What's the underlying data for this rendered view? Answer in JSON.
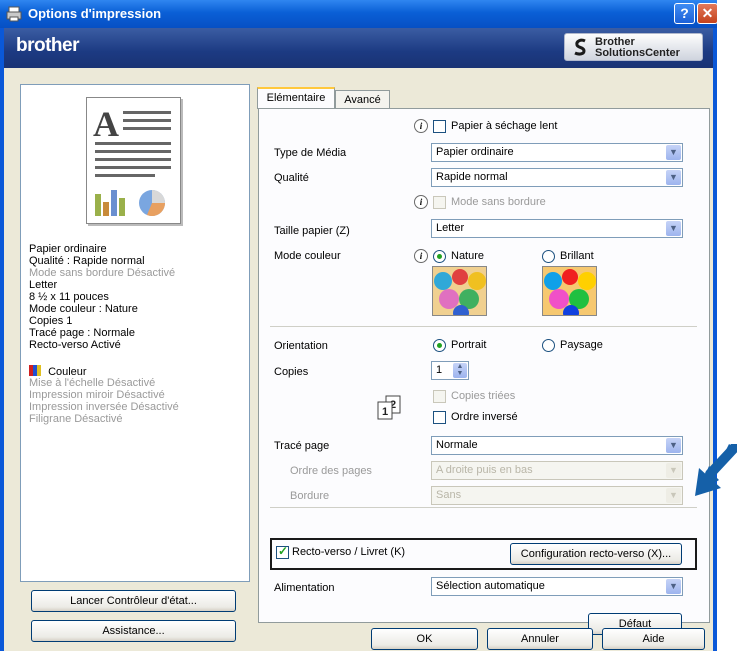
{
  "window": {
    "title": "Options d'impression",
    "help_label": "?",
    "close_label": "✕"
  },
  "banner": {
    "brand": "brother",
    "solutions_line1": "Brother",
    "solutions_line2": "SolutionsCenter"
  },
  "summary": {
    "line1": "Papier ordinaire",
    "line2": "Qualité : Rapide normal",
    "line3": "Mode sans bordure Désactivé",
    "line4": "Letter",
    "line5": "8 ½ x 11 pouces",
    "line6": "Mode couleur : Nature",
    "line7": "Copies 1",
    "line8": "Tracé page : Normale",
    "line9": "Recto-verso Activé",
    "color_label": "Couleur",
    "line10": "Mise à l'échelle Désactivé",
    "line11": "Impression miroir Désactivé",
    "line12": "Impression inversée Désactivé",
    "line13": "Filigrane Désactivé"
  },
  "buttons": {
    "status_monitor": "Lancer Contrôleur d'état...",
    "support": "Assistance...",
    "default": "Défaut",
    "ok": "OK",
    "cancel": "Annuler",
    "help": "Aide",
    "duplex_settings": "Configuration  recto-verso (X)..."
  },
  "tabs": {
    "basic": "Elémentaire",
    "advanced": "Avancé"
  },
  "form": {
    "slow_dry": "Papier à séchage lent",
    "media_type_label": "Type de Média",
    "media_type_value": "Papier ordinaire",
    "quality_label": "Qualité",
    "quality_value": "Rapide normal",
    "borderless": "Mode sans bordure",
    "paper_size_label": "Taille papier (Z)",
    "paper_size_value": "Letter",
    "color_mode_label": "Mode couleur",
    "color_natural": "Nature",
    "color_vivid": "Brillant",
    "orientation_label": "Orientation",
    "portrait": "Portrait",
    "landscape": "Paysage",
    "copies_label": "Copies",
    "copies_value": "1",
    "collate": "Copies triées",
    "reverse_order": "Ordre inversé",
    "page_layout_label": "Tracé page",
    "page_layout_value": "Normale",
    "page_order_label": "Ordre des pages",
    "page_order_value": "A droite puis en bas",
    "border_label": "Bordure",
    "border_value": "Sans",
    "duplex": "Recto-verso / Livret (K)",
    "paper_source_label": "Alimentation",
    "paper_source_value": "Sélection automatique"
  },
  "colors": {
    "accent": "#0a5fd6",
    "banner": "#1c3a82",
    "highlight_arrow": "#1560a8",
    "check": "#21a121"
  }
}
